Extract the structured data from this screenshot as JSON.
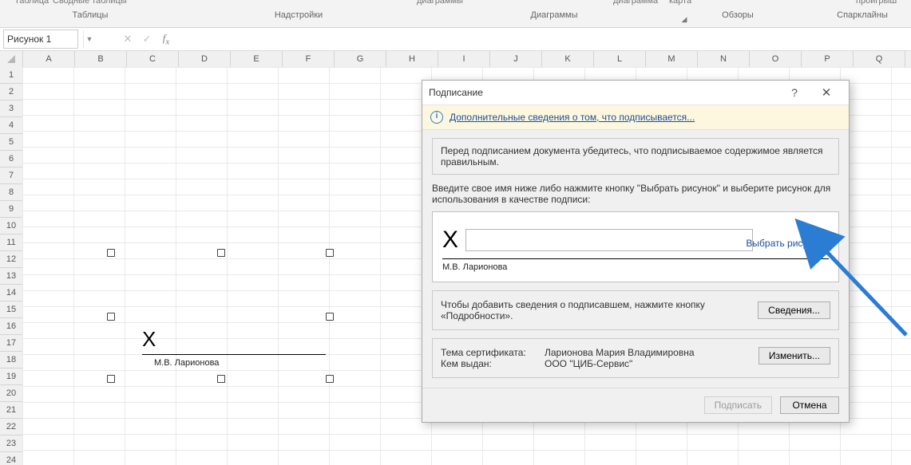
{
  "ribbon_cut": {
    "t1": "Таблица",
    "t2": "Сводные таблицы",
    "t3": "диаграммы",
    "t4": "диаграмма",
    "t5": "карта",
    "t6": "проигрыш"
  },
  "ribbon": {
    "g1": "Таблицы",
    "g2": "Надстройки",
    "g3": "Диаграммы",
    "g4": "Обзоры",
    "g5": "Спарклайны"
  },
  "namebox": "Рисунок 1",
  "cols": [
    "A",
    "B",
    "C",
    "D",
    "E",
    "F",
    "G",
    "H",
    "I",
    "J",
    "K",
    "L",
    "M",
    "N",
    "O",
    "P",
    "Q"
  ],
  "rows": [
    "1",
    "2",
    "3",
    "4",
    "5",
    "6",
    "7",
    "8",
    "9",
    "10",
    "11",
    "12",
    "13",
    "14",
    "15",
    "16",
    "17",
    "18",
    "19",
    "20",
    "21",
    "22",
    "23",
    "24"
  ],
  "sheet_sig": {
    "x": "X",
    "name": "М.В. Ларионова"
  },
  "dialog": {
    "title": "Подписание",
    "info_link": "Дополнительные сведения о том, что подписывается...",
    "warn": "Перед подписанием документа убедитесь, что подписываемое содержимое является правильным.",
    "instruction": "Введите свое имя ниже либо нажмите кнопку \"Выбрать рисунок\" и выберите рисунок для использования в качестве подписи:",
    "bigX": "X",
    "choose_picture": "Выбрать рисунок...",
    "sig_name": "М.В. Ларионова",
    "add_info_text": "Чтобы добавить сведения о подписавшем, нажмите кнопку «Подробности».",
    "details_btn": "Сведения...",
    "cert_topic_label": "Тема сертификата:",
    "cert_topic_value": "Ларионова Мария Владимировна",
    "cert_issuer_label": "Кем выдан:",
    "cert_issuer_value": "ООО \"ЦИБ-Сервис\"",
    "change_btn": "Изменить...",
    "sign_btn": "Подписать",
    "cancel_btn": "Отмена"
  }
}
